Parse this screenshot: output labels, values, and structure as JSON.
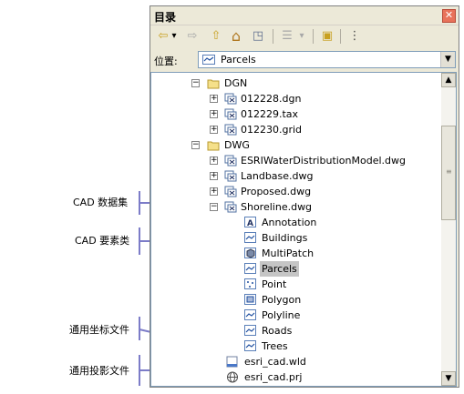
{
  "window": {
    "title": "目录",
    "close_glyph": "✕"
  },
  "toolbar": {
    "back_glyph": "⇦",
    "back_dropdown_glyph": "▾",
    "forward_glyph": "⇨",
    "up_glyph": "⇧",
    "home_glyph": "⌂",
    "connect_glyph": "◳",
    "view_glyph": "☰",
    "view_dropdown_glyph": "▾",
    "new_folder_glyph": "▣",
    "options_glyph": "⋮"
  },
  "location": {
    "label": "位置:",
    "value": "Parcels",
    "dropdown_glyph": "▼"
  },
  "scroll": {
    "up_glyph": "▲",
    "down_glyph": "▼"
  },
  "tree": {
    "expand_glyph": "+",
    "collapse_glyph": "−",
    "items": [
      {
        "label": "DGN"
      },
      {
        "label": "012228.dgn"
      },
      {
        "label": "012229.tax"
      },
      {
        "label": "012230.grid"
      },
      {
        "label": "DWG"
      },
      {
        "label": "ESRIWaterDistributionModel.dwg"
      },
      {
        "label": "Landbase.dwg"
      },
      {
        "label": "Proposed.dwg"
      },
      {
        "label": "Shoreline.dwg"
      },
      {
        "label": "Annotation"
      },
      {
        "label": "Buildings"
      },
      {
        "label": "MultiPatch"
      },
      {
        "label": "Parcels"
      },
      {
        "label": "Point"
      },
      {
        "label": "Polygon"
      },
      {
        "label": "Polyline"
      },
      {
        "label": "Roads"
      },
      {
        "label": "Trees"
      },
      {
        "label": "esri_cad.wld"
      },
      {
        "label": "esri_cad.prj"
      }
    ]
  },
  "callouts": {
    "cad_dataset": "CAD 数据集",
    "cad_feature_class": "CAD 要素类",
    "world_file": "通用坐标文件",
    "projection_file": "通用投影文件"
  }
}
